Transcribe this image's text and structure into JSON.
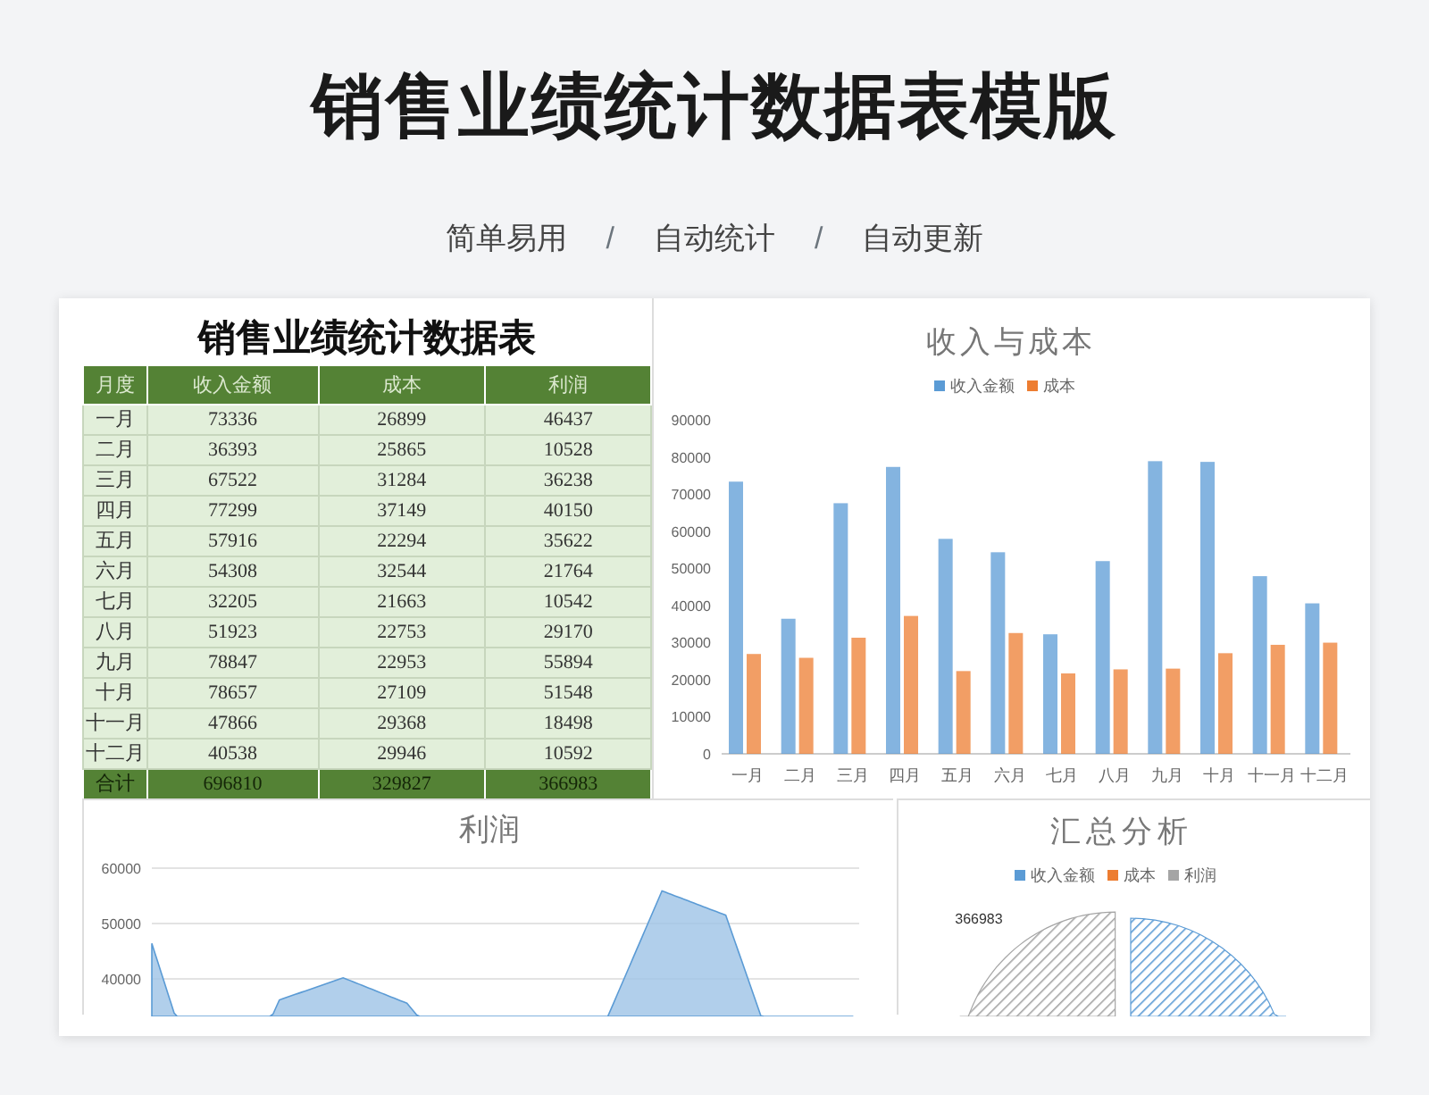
{
  "header": {
    "title": "销售业绩统计数据表模版",
    "taglines": [
      "简单易用",
      "自动统计",
      "自动更新"
    ],
    "separators": [
      "/",
      "/"
    ]
  },
  "table": {
    "title": "销售业绩统计数据表",
    "columns": [
      "月度",
      "收入金额",
      "成本",
      "利润"
    ],
    "rows": [
      [
        "一月",
        "73336",
        "26899",
        "46437"
      ],
      [
        "二月",
        "36393",
        "25865",
        "10528"
      ],
      [
        "三月",
        "67522",
        "31284",
        "36238"
      ],
      [
        "四月",
        "77299",
        "37149",
        "40150"
      ],
      [
        "五月",
        "57916",
        "22294",
        "35622"
      ],
      [
        "六月",
        "54308",
        "32544",
        "21764"
      ],
      [
        "七月",
        "32205",
        "21663",
        "10542"
      ],
      [
        "八月",
        "51923",
        "22753",
        "29170"
      ],
      [
        "九月",
        "78847",
        "22953",
        "55894"
      ],
      [
        "十月",
        "78657",
        "27109",
        "51548"
      ],
      [
        "十一月",
        "47866",
        "29368",
        "18498"
      ],
      [
        "十二月",
        "40538",
        "29946",
        "10592"
      ]
    ],
    "total": [
      "合计",
      "696810",
      "329827",
      "366983"
    ]
  },
  "revenue_chart": {
    "chart_data": {
      "type": "bar",
      "title": "收入与成本",
      "categories": [
        "一月",
        "二月",
        "三月",
        "四月",
        "五月",
        "六月",
        "七月",
        "八月",
        "九月",
        "十月",
        "十一月",
        "十二月"
      ],
      "series": [
        {
          "name": "收入金额",
          "color": "#5b9bd5",
          "values": [
            73336,
            36393,
            67522,
            77299,
            57916,
            54308,
            32205,
            51923,
            78847,
            78657,
            47866,
            40538
          ]
        },
        {
          "name": "成本",
          "color": "#ed7d31",
          "values": [
            26899,
            25865,
            31284,
            37149,
            22294,
            32544,
            21663,
            22753,
            22953,
            27109,
            29368,
            29946
          ]
        }
      ],
      "legend": "top",
      "ylim": [
        0,
        90000
      ],
      "yticks": [
        0,
        10000,
        20000,
        30000,
        40000,
        50000,
        60000,
        70000,
        80000,
        90000
      ]
    }
  },
  "profit_chart": {
    "title": "利润",
    "axis_labels": [
      "60000",
      "50000",
      "40000"
    ]
  },
  "summary_chart": {
    "title": "汇总分析",
    "legend": [
      {
        "name": "收入金额",
        "color": "#5b9bd5"
      },
      {
        "name": "成本",
        "color": "#ed7d31"
      },
      {
        "name": "利润",
        "color": "#a5a5a5"
      }
    ],
    "data_label": "366983"
  }
}
